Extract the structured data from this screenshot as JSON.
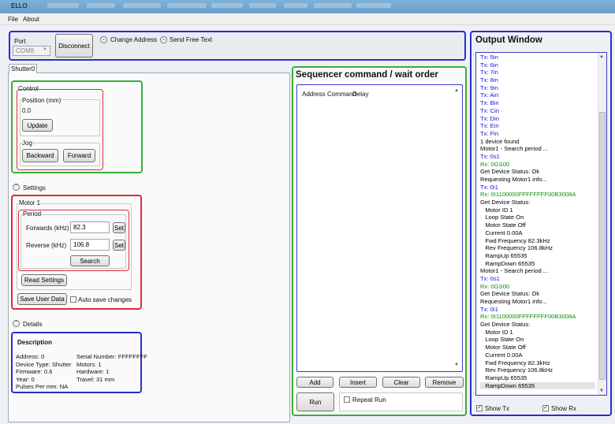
{
  "window": {
    "title": "ELLO"
  },
  "menu": [
    "File",
    "About"
  ],
  "connection": {
    "port_label": "Port",
    "port_value": "COM8",
    "disconnect_label": "Disconnect",
    "change_address_label": "Change Address",
    "send_free_text_label": "Send Free Text"
  },
  "tabs": [
    "Shutter0"
  ],
  "control": {
    "title": "Control",
    "position_title": "Position (mm)",
    "position_value": "0.0",
    "update_label": "Update",
    "jog_title": "Jog",
    "backward_label": "Backward",
    "forward_label": "Forward"
  },
  "settings": {
    "title": "Settings",
    "motor_title": "Motor 1",
    "period_title": "Period",
    "forwards_label": "Forwards (kHz)",
    "forwards_value": "82.3",
    "reverse_label": "Reverse (kHz)",
    "reverse_value": "106.8",
    "set_label": "Set",
    "search_label": "Search",
    "read_settings_label": "Read Settings",
    "save_user_data_label": "Save User Data",
    "auto_save_label": "Auto save changes"
  },
  "details": {
    "title": "Details",
    "description_title": "Description",
    "left": [
      "Address: 0",
      "Device Type: Shutter",
      "Firmware: 0.6",
      "Year: 0",
      "Pulses Per mm: NA"
    ],
    "right": [
      "Serial Number: FFFFFFFF",
      "Motors: 1",
      "Hardware: 1",
      "Travel: 31 mm"
    ]
  },
  "sequencer": {
    "title": "Sequencer command / wait order",
    "columns": [
      "Address",
      "Command",
      "Delay"
    ],
    "add_label": "Add",
    "insert_label": "Insert",
    "clear_label": "Clear",
    "remove_label": "Remove",
    "run_label": "Run",
    "repeat_run_label": "Repeat Run"
  },
  "output": {
    "title": "Output Window",
    "lines": [
      {
        "t": "Tx: 5in",
        "k": "tx"
      },
      {
        "t": "Tx: 6in",
        "k": "tx"
      },
      {
        "t": "Tx: 7in",
        "k": "tx"
      },
      {
        "t": "Tx: 8in",
        "k": "tx"
      },
      {
        "t": "Tx: 9in",
        "k": "tx"
      },
      {
        "t": "Tx: Ain",
        "k": "tx"
      },
      {
        "t": "Tx: Bin",
        "k": "tx"
      },
      {
        "t": "Tx: Cin",
        "k": "tx"
      },
      {
        "t": "Tx: Din",
        "k": "tx"
      },
      {
        "t": "Tx: Ein",
        "k": "tx"
      },
      {
        "t": "Tx: Fin",
        "k": "tx"
      },
      {
        "t": "1 device found",
        "k": "info"
      },
      {
        "t": "Motor1 - Search period ...",
        "k": "info"
      },
      {
        "t": "Tx: 0s1",
        "k": "tx"
      },
      {
        "t": "Rx: 0GS00",
        "k": "rx"
      },
      {
        "t": "Get Device Status: Ok",
        "k": "info"
      },
      {
        "t": "Requesting Motor1 info...",
        "k": "info"
      },
      {
        "t": "Tx: 0i1",
        "k": "tx"
      },
      {
        "t": "Rx: 0I1100000FFFFFFFF00B3008A",
        "k": "rx"
      },
      {
        "t": "Get Device Status:",
        "k": "info"
      },
      {
        "t": "   Motor ID 1",
        "k": "info"
      },
      {
        "t": "   Loop State On",
        "k": "info"
      },
      {
        "t": "   Motor State Off",
        "k": "info"
      },
      {
        "t": "   Current 0.00A",
        "k": "info"
      },
      {
        "t": "   Fwd Frequency 82.3kHz",
        "k": "info"
      },
      {
        "t": "   Rev Frequency 106.8kHz",
        "k": "info"
      },
      {
        "t": "   RampUp 65535",
        "k": "info"
      },
      {
        "t": "   RampDown 65535",
        "k": "info"
      },
      {
        "t": "Motor1 - Search period ...",
        "k": "info"
      },
      {
        "t": "Tx: 0s1",
        "k": "tx"
      },
      {
        "t": "Rx: 0GS00",
        "k": "rx"
      },
      {
        "t": "Get Device Status: Ok",
        "k": "info"
      },
      {
        "t": "Requesting Motor1 info...",
        "k": "info"
      },
      {
        "t": "Tx: 0i1",
        "k": "tx"
      },
      {
        "t": "Rx: 0I1100000FFFFFFFF00B3008A",
        "k": "rx"
      },
      {
        "t": "Get Device Status:",
        "k": "info"
      },
      {
        "t": "   Motor ID 1",
        "k": "info"
      },
      {
        "t": "   Loop State On",
        "k": "info"
      },
      {
        "t": "   Motor State Off",
        "k": "info"
      },
      {
        "t": "   Current 0.00A",
        "k": "info"
      },
      {
        "t": "   Fwd Frequency 82.3kHz",
        "k": "info"
      },
      {
        "t": "   Rev Frequency 106.8kHz",
        "k": "info"
      },
      {
        "t": "   RampUp 65535",
        "k": "info"
      },
      {
        "t": "   RampDown 65535",
        "k": "sel"
      }
    ],
    "show_tx_label": "Show Tx",
    "show_rx_label": "Show Rx"
  },
  "colors": {
    "blue_frame": "#2c2ccf",
    "green_frame": "#35b035",
    "red_frame": "#e02a3d",
    "tx_text": "#1515d6",
    "rx_text": "#0a8f0a"
  }
}
